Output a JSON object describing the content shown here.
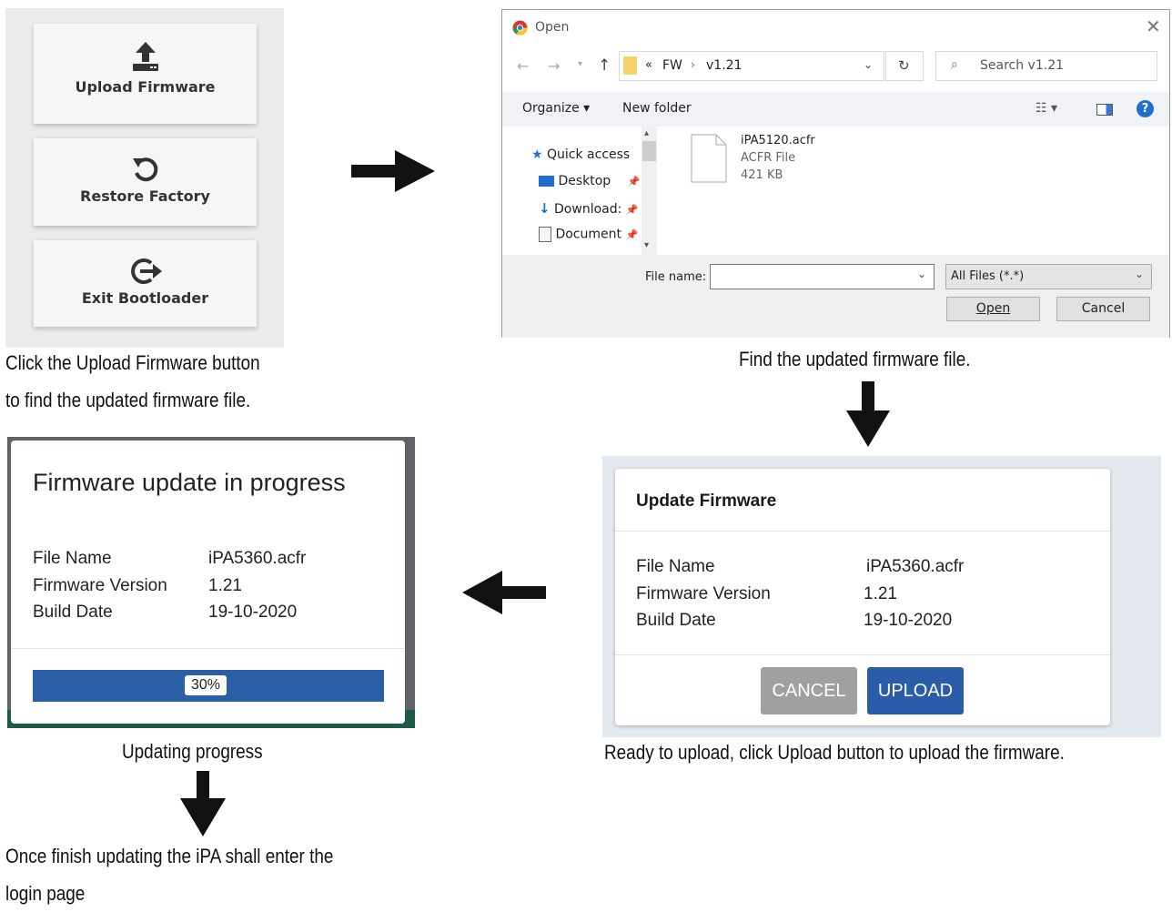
{
  "bootloader": {
    "upload_label": "Upload Firmware",
    "restore_label": "Restore Factory",
    "exit_label": "Exit Bootloader"
  },
  "captions": {
    "step1_line1": "Click  the  Upload  Firmware  button",
    "step1_line2": "to find the updated firmware file.",
    "step2": "Find the updated firmware file.",
    "step3": "Ready to upload, click Upload button to upload the firmware.",
    "step4": "Updating progress",
    "step5_line1": "Once  finish  updating  the  iPA  shall  enter  the",
    "step5_line2": "login page"
  },
  "open_dialog": {
    "title": "Open",
    "breadcrumb_prefix": "«",
    "breadcrumb_folder": "FW",
    "breadcrumb_sub": "v1.21",
    "search_placeholder": "Search v1.21",
    "organize_label": "Organize ▾",
    "new_folder_label": "New folder",
    "nav_items": [
      {
        "label": "Quick access",
        "icon": "star-icon"
      },
      {
        "label": "Desktop",
        "icon": "desktop-icon"
      },
      {
        "label": "Download:",
        "icon": "download-icon"
      },
      {
        "label": "Document",
        "icon": "document-icon"
      }
    ],
    "file": {
      "name": "iPA5120.acfr",
      "type": "ACFR File",
      "size": "421 KB"
    },
    "file_name_label": "File name:",
    "file_name_value": "",
    "filter_value": "All Files (*.*)",
    "open_label": "Open",
    "cancel_label": "Cancel"
  },
  "update_dialog": {
    "title": "Update Firmware",
    "rows": [
      {
        "label": "File Name",
        "value": "iPA5360.acfr"
      },
      {
        "label": "Firmware Version",
        "value": "1.21"
      },
      {
        "label": "Build Date",
        "value": "19-10-2020"
      }
    ],
    "cancel_label": "CANCEL",
    "upload_label": "UPLOAD",
    "cancel_color": "#a0a0a0",
    "upload_color": "#2a5caa"
  },
  "progress_dialog": {
    "title": "Firmware update in progress",
    "rows": [
      {
        "label": "File Name",
        "value": "iPA5360.acfr"
      },
      {
        "label": "Firmware Version",
        "value": "1.21"
      },
      {
        "label": "Build Date",
        "value": "19-10-2020"
      }
    ],
    "progress_text": "30%",
    "progress_fraction": 0.3,
    "bar_color": "#2a5fa6"
  }
}
